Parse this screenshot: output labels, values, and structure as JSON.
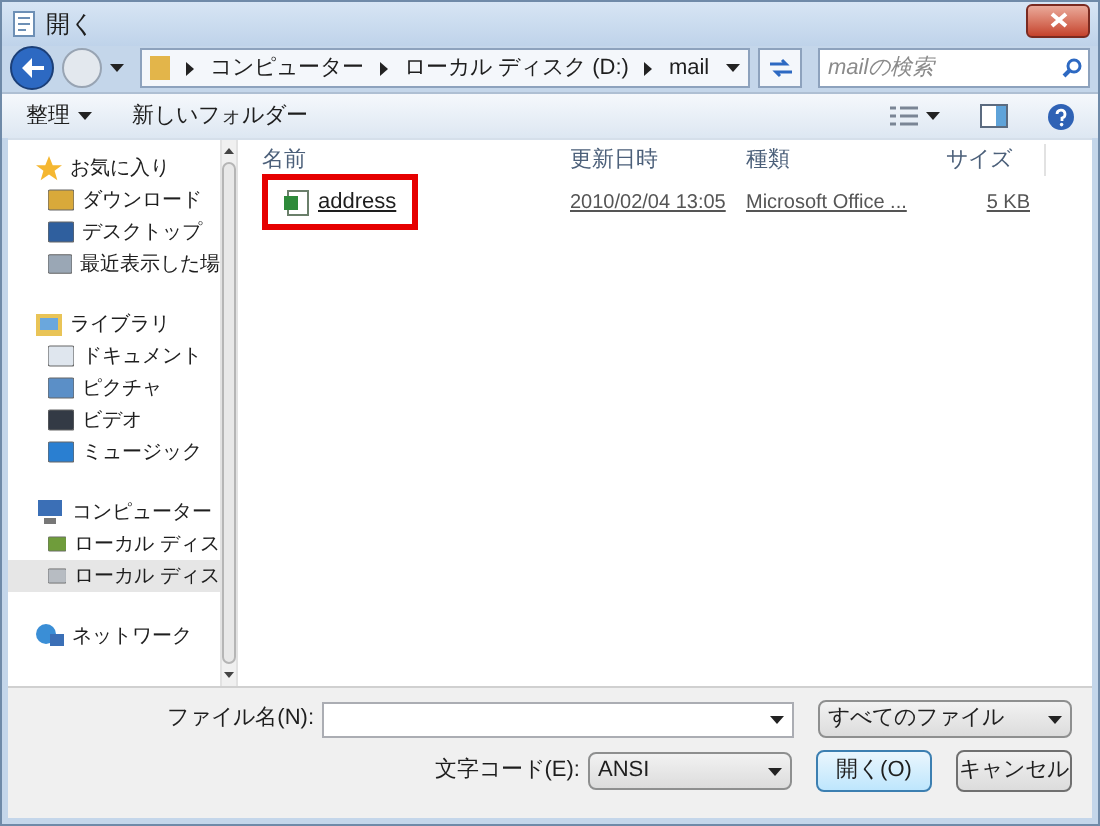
{
  "window": {
    "title": "開く"
  },
  "breadcrumb": [
    "コンピューター",
    "ローカル ディスク (D:)",
    "mail"
  ],
  "search": {
    "placeholder": "mailの検索"
  },
  "toolbar": {
    "organize": "整理",
    "new_folder": "新しいフォルダー"
  },
  "sidebar": {
    "groups": [
      {
        "label": "お気に入り",
        "children": [
          {
            "label": "ダウンロード",
            "selected": false
          },
          {
            "label": "デスクトップ",
            "selected": false
          },
          {
            "label": "最近表示した場",
            "selected": false
          }
        ]
      },
      {
        "label": "ライブラリ",
        "children": [
          {
            "label": "ドキュメント",
            "selected": false
          },
          {
            "label": "ピクチャ",
            "selected": false
          },
          {
            "label": "ビデオ",
            "selected": false
          },
          {
            "label": "ミュージック",
            "selected": false
          }
        ]
      },
      {
        "label": "コンピューター",
        "children": [
          {
            "label": "ローカル ディス",
            "selected": false
          },
          {
            "label": "ローカル ディス",
            "selected": true
          }
        ]
      },
      {
        "label": "ネットワーク"
      }
    ]
  },
  "table": {
    "columns": [
      "名前",
      "更新日時",
      "種類",
      "サイズ"
    ],
    "rows": [
      {
        "name": "address",
        "modified": "2010/02/04 13:05",
        "type": "Microsoft Office ...",
        "size": "5 KB",
        "highlighted": true
      }
    ]
  },
  "footer": {
    "filename_label": "ファイル名(N):",
    "filetype": "すべてのファイル",
    "encoding_label": "文字コード(E):",
    "encoding": "ANSI",
    "open_button": "開く(O)",
    "cancel_button": "キャンセル"
  }
}
